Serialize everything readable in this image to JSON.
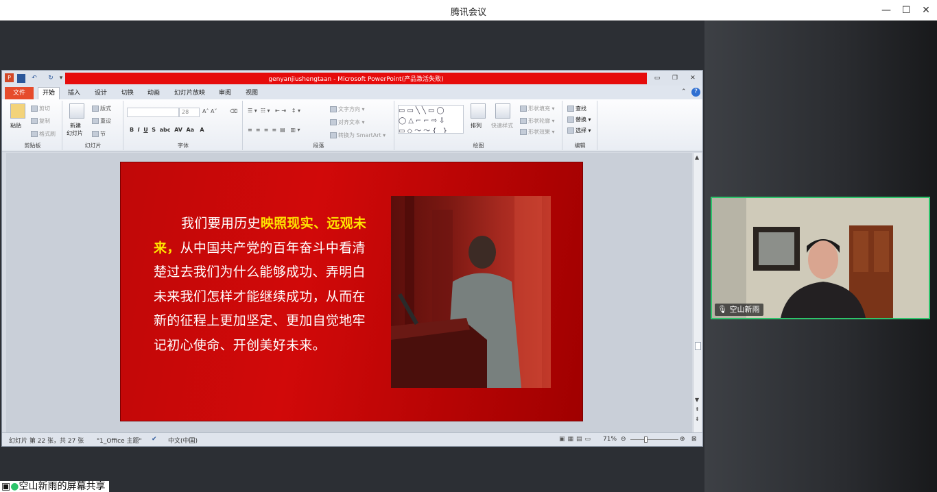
{
  "app": {
    "title": "腾讯会议"
  },
  "window_controls": {
    "minimize": "—",
    "maximize": "☐",
    "close": "✕"
  },
  "ppt": {
    "title": "genyanjiushengtaan  -  Microsoft PowerPoint(产品激活失败)",
    "tabs": [
      "文件",
      "开始",
      "插入",
      "设计",
      "切换",
      "动画",
      "幻灯片放映",
      "审阅",
      "视图"
    ],
    "groups": {
      "clipboard": {
        "label": "剪贴板",
        "paste": "粘贴",
        "cut": "剪切",
        "copy": "复制",
        "format_painter": "格式刷"
      },
      "slides": {
        "label": "幻灯片",
        "new_slide": "新建",
        "new_slide2": "幻灯片",
        "layout": "版式",
        "reset": "重设",
        "section": "节"
      },
      "font": {
        "label": "字体",
        "size": "28"
      },
      "paragraph": {
        "label": "段落",
        "text_direction": "文字方向",
        "align_text": "对齐文本",
        "smartart": "转换为 SmartArt"
      },
      "drawing": {
        "label": "绘图",
        "arrange": "排列",
        "quick_styles": "快速样式",
        "shape_fill": "形状填充",
        "shape_outline": "形状轮廓",
        "shape_effects": "形状效果"
      },
      "editing": {
        "label": "编辑",
        "find": "查找",
        "replace": "替换",
        "select": "选择"
      }
    },
    "status": {
      "slide_info": "幻灯片 第 22 张，共 27 张",
      "theme": "\"1_Office 主题\"",
      "language": "中文(中国)",
      "zoom": "71%"
    },
    "slide": {
      "text_lead": "我们要用历史",
      "text_highlight": "映照现实、远观未来，",
      "text_rest": "从中国共产党的百年奋斗中看清楚过去我们为什么能够成功、弄明白未来我们怎样才能继续成功，从而在新的征程上更加坚定、更加自觉地牢记初心使命、开创美好未来。"
    }
  },
  "participant": {
    "name": "空山新雨"
  },
  "share_banner": "空山新雨的屏幕共享",
  "colors": {
    "accent_green": "#2dc46b",
    "ppt_red": "#e60c0c",
    "highlight_yellow": "#ffe400"
  }
}
